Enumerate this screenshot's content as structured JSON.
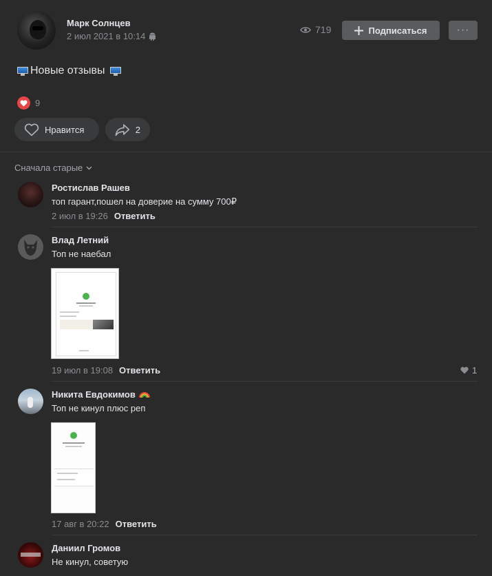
{
  "post": {
    "author": "Марк Солнцев",
    "date": "2 июл 2021 в 10:14",
    "views": "719",
    "subscribe_label": "Подписаться",
    "more_label": "···",
    "text": "Новые отзывы",
    "reactions_count": "9",
    "like_label": "Нравится",
    "shares_count": "2"
  },
  "comments_sort": "Сначала старые",
  "comments": [
    {
      "name": "Ростислав Рашев",
      "text": "топ гарант,пошел на доверие на сумму 700₽",
      "date": "2 июл в 19:26",
      "reply": "Ответить"
    },
    {
      "name": "Влад Летний",
      "text": "Топ не наебал",
      "date": "19 июл в 19:08",
      "reply": "Ответить",
      "likes": "1"
    },
    {
      "name": "Никита Евдокимов",
      "text": "Топ не кинул плюс реп",
      "date": "17 авг в 20:22",
      "reply": "Ответить"
    },
    {
      "name": "Даниил Громов",
      "text": "Не кинул, советую"
    }
  ],
  "colors": {
    "background": "#2a2a2b",
    "button": "#5a5b5d",
    "reaction": "#e64646",
    "text": "#e1e3e6",
    "muted": "#8a8d91"
  }
}
